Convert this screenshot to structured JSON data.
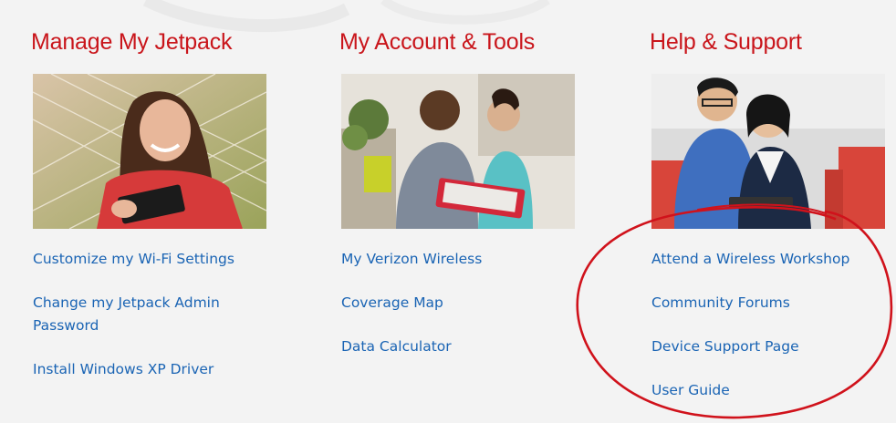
{
  "columns": [
    {
      "title": "Manage My Jetpack",
      "image": "woman-with-tablet-in-hammock-photo",
      "links": [
        "Customize my Wi-Fi Settings",
        "Change my Jetpack Admin Password",
        "Install Windows XP Driver"
      ]
    },
    {
      "title": "My Account & Tools",
      "image": "couple-with-red-tablet-photo",
      "links": [
        "My Verizon Wireless",
        "Coverage Map",
        "Data Calculator"
      ]
    },
    {
      "title": "Help & Support",
      "image": "man-and-woman-looking-at-tablet-photo",
      "links": [
        "Attend a Wireless Workshop",
        "Community Forums",
        "Device Support Page",
        "User Guide"
      ]
    }
  ],
  "annotation": {
    "shape": "hand-drawn-ellipse",
    "color": "#d0121b",
    "target": "help-support-links"
  }
}
